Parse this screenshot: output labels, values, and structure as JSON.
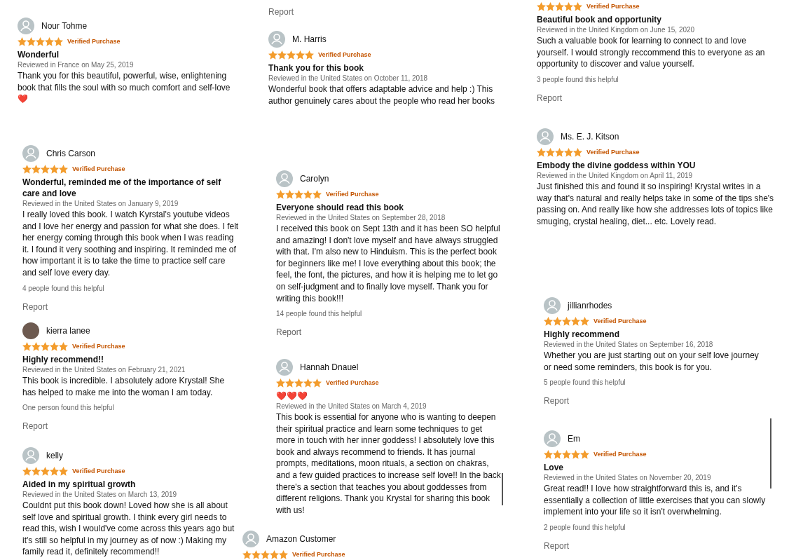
{
  "reviews": [
    {
      "name": "Nour Tohme",
      "stars": 5,
      "badge": "Verified Purchase",
      "title": "Wonderful",
      "meta": "Reviewed in France on May 25, 2019",
      "body": "Thank you for this beautiful, powerful, wise, enlightening book that fills the soul with so much comfort and self-love\n❤️"
    },
    {
      "report": "Report"
    },
    {
      "name": "M. Harris",
      "stars": 5,
      "badge": "Verified Purchase",
      "title": "Thank you for this book",
      "meta": "Reviewed in the United States on October 11, 2018",
      "body": "Wonderful book that offers adaptable advice and help :) This author genuinely cares about the people who read her books"
    },
    {
      "stars": 5,
      "badge": "Verified Purchase",
      "title": "Beautiful book and opportunity",
      "meta": "Reviewed in the United Kingdom on June 15, 2020",
      "body": "Such a valuable book for learning to connect to and love yourself. I would strongly reccommend this to everyone as an opportunity to discover and value yourself.",
      "helpful": "3 people found this helpful",
      "report": "Report"
    },
    {
      "name": "Chris Carson",
      "stars": 5,
      "badge": "Verified Purchase",
      "title": "Wonderful, reminded me of the importance of self care and love",
      "meta": "Reviewed in the United States on January 9, 2019",
      "body": "I really loved this book. I watch Kyrstal's youtube videos and I love her energy and passion for what she does. I felt her energy coming through this book when I was reading it. I found it very soothing and inspiring. It reminded me of how important it is to take the time to practice self care and self love every day.",
      "helpful": "4 people found this helpful",
      "report": "Report"
    },
    {
      "name": "Ms. E. J. Kitson",
      "stars": 5,
      "badge": "Verified Purchase",
      "title": "Embody the divine goddess within YOU",
      "meta": "Reviewed in the United Kingdom on April 11, 2019",
      "body": "Just finished this and found it so inspiring! Krystal writes in a way that's natural and really helps take in some of the tips she's passing on. And really like how she addresses lots of topics like smuging, crystal healing, diet... etc. Lovely read."
    },
    {
      "name": "Carolyn",
      "stars": 5,
      "badge": "Verified Purchase",
      "title": "Everyone should read this book",
      "meta": "Reviewed in the United States on September 28, 2018",
      "body": "I received this book on Sept 13th and it has been SO helpful and amazing! I don't love myself and have always struggled with that. I'm also new to Hinduism. This is the perfect book for beginners like me! I love everything about this book; the feel, the font, the pictures, and how it is helping me to let go on self-judgment and to finally love myself. Thank you for writing this book!!!",
      "helpful": "14 people found this helpful",
      "report": "Report"
    },
    {
      "name": "kierra lanee",
      "photo_avatar": true,
      "stars": 5,
      "badge": "Verified Purchase",
      "title": "Highly recommend!!",
      "meta": "Reviewed in the United States on February 21, 2021",
      "body": "This book is incredible. I absolutely adore Krystal! She has helped to make me into the woman I am today.",
      "helpful": "One person found this helpful",
      "report": "Report"
    },
    {
      "name": "jillianrhodes",
      "stars": 5,
      "badge": "Verified Purchase",
      "title": "Highly recommend",
      "meta": "Reviewed in the United States on September 16, 2018",
      "body": "Whether you are just starting out on your self love journey or need some reminders, this book is for you.",
      "helpful": "5 people found this helpful",
      "report": "Report"
    },
    {
      "name": "Hannah Dnauel",
      "stars": 5,
      "badge": "Verified Purchase",
      "title": "❤️❤️❤️",
      "meta": "Reviewed in the United States on March 4, 2019",
      "body": "This book is essential for anyone who is wanting to deepen their spiritual practice and learn some techniques to get more in touch with her inner goddess! I absolutely love this book and always recommend to friends. It has journal prompts, meditations, moon rituals, a section on chakras, and a few guided practices to increase self love!! In the back there's a section that teaches you about goddesses from different religions. Thank you Krystal for sharing this book with us!"
    },
    {
      "name": "kelly",
      "stars": 5,
      "badge": "Verified Purchase",
      "title": "Aided in my spiritual growth",
      "meta": "Reviewed in the United States on March 13, 2019",
      "body": "Couldnt put this book down! Loved how she is all about self love and spiritual growth. I think every girl needs to read this, wish I would've come across this years ago but it's still so helpful in my journey as of now :) Making my family read it, definitely recommend!!"
    },
    {
      "name": "Amazon Customer",
      "stars": 5,
      "badge": "Verified Purchase"
    },
    {
      "name": "Em",
      "stars": 5,
      "badge": "Verified Purchase",
      "title": "Love",
      "meta": "Reviewed in the United States on November 20, 2019",
      "body": "Great read!! I love how straightforward this is, and it's essentially a collection of little exercises that you can slowly implement into your life so it isn't overwhelming.",
      "helpful": "2 people found this helpful",
      "report": "Report"
    }
  ]
}
